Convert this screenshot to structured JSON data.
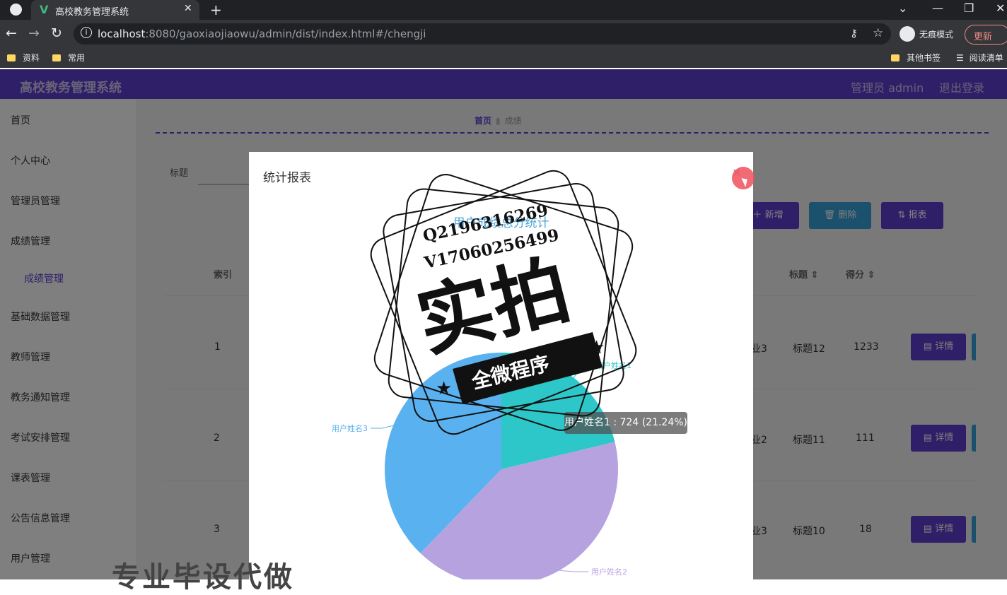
{
  "browser": {
    "tab_title": "高校教务管理系统",
    "url_host": "localhost",
    "url_rest": ":8080/gaoxiaojiaowu/admin/dist/index.html#/chengji",
    "incognito_label": "无痕模式",
    "update_label": "更新",
    "bookmarks": [
      "资料",
      "常用"
    ],
    "other_bookmarks": "其他书签",
    "reading_list": "阅读清单"
  },
  "app": {
    "brand": "高校教务管理系统",
    "user": "管理员 admin",
    "logout": "退出登录"
  },
  "sidebar": {
    "items": [
      {
        "label": "首页"
      },
      {
        "label": "个人中心"
      },
      {
        "label": "管理员管理"
      },
      {
        "label": "成绩管理"
      },
      {
        "label": "成绩管理"
      },
      {
        "label": "基础数据管理"
      },
      {
        "label": "教师管理"
      },
      {
        "label": "教务通知管理"
      },
      {
        "label": "考试安排管理"
      },
      {
        "label": "课表管理"
      },
      {
        "label": "公告信息管理"
      },
      {
        "label": "用户管理"
      }
    ]
  },
  "breadcrumb": {
    "home": "首页",
    "current": "成绩"
  },
  "filter": {
    "label": "标题"
  },
  "actions": {
    "add": "新增",
    "delete": "删除",
    "report": "报表"
  },
  "table": {
    "headers": {
      "index": "索引",
      "title": "标题",
      "score": "得分"
    },
    "rows": [
      {
        "index": "1",
        "col": "业3",
        "title": "标题12",
        "score": "1233",
        "detail": "详情"
      },
      {
        "index": "2",
        "col": "业2",
        "title": "标题11",
        "score": "111",
        "detail": "详情"
      },
      {
        "index": "3",
        "col": "业3",
        "title": "标题10",
        "score": "18",
        "detail": "详情"
      }
    ]
  },
  "modal": {
    "title": "统计报表",
    "close_icon": "close-icon"
  },
  "chart_data": {
    "type": "pie",
    "title": "用户成绩总分统计",
    "series": [
      {
        "name": "用户姓名1",
        "value": 724,
        "percent": 21.24,
        "color": "#2ec7c9"
      },
      {
        "name": "用户姓名2",
        "value": 1396,
        "percent": 40.96,
        "color": "#b6a2de"
      },
      {
        "name": "用户姓名3",
        "value": 1288,
        "percent": 37.8,
        "color": "#5ab1ef"
      }
    ],
    "tooltip": "用户姓名1 : 724 (21.24%)"
  },
  "watermark": {
    "line1": "Q2196316269",
    "line2": "V17060256499",
    "big": "实拍",
    "ribbon": "全微程序",
    "bottom": "专业毕设代做"
  }
}
